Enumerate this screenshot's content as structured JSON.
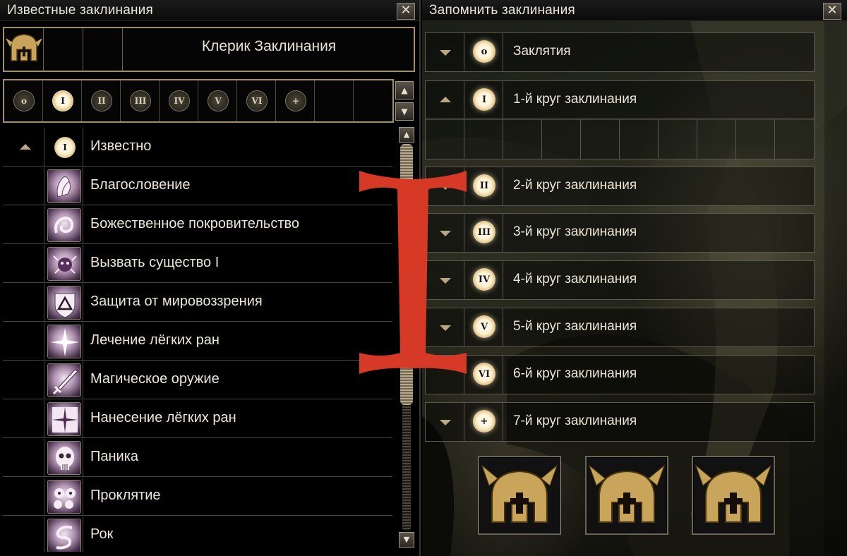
{
  "known_window": {
    "title": "Известные заклинания",
    "close_label": "✕",
    "class_name": "Клерик Заклинания",
    "level_tabs": [
      {
        "label": "o",
        "active": false
      },
      {
        "label": "I",
        "active": true
      },
      {
        "label": "II",
        "active": false
      },
      {
        "label": "III",
        "active": false
      },
      {
        "label": "IV",
        "active": false
      },
      {
        "label": "V",
        "active": false
      },
      {
        "label": "VI",
        "active": false
      },
      {
        "label": "+",
        "active": false
      },
      {
        "label": "",
        "active": false
      },
      {
        "label": "",
        "active": false
      }
    ],
    "spin_up": "▲",
    "spin_down": "▼",
    "list_header": {
      "rune": "I",
      "label": "Известно"
    },
    "spells": [
      {
        "label": "Благословение",
        "icon": "praying-hands-icon"
      },
      {
        "label": "Божественное покровительство",
        "icon": "ankh-swirl-icon"
      },
      {
        "label": "Вызвать существо I",
        "icon": "summon-creature-icon"
      },
      {
        "label": "Защита от мировоззрения",
        "icon": "shield-triangle-icon"
      },
      {
        "label": "Лечение лёгких ран",
        "icon": "healing-star-icon"
      },
      {
        "label": "Магическое оружие",
        "icon": "sword-icon"
      },
      {
        "label": "Нанесение лёгких ран",
        "icon": "wound-star-icon"
      },
      {
        "label": "Паника",
        "icon": "skull-icon"
      },
      {
        "label": "Проклятие",
        "icon": "curse-faces-icon"
      },
      {
        "label": "Рок",
        "icon": "doom-snake-icon"
      }
    ],
    "scroll_up": "▲",
    "scroll_down": "▼"
  },
  "memorize_window": {
    "title": "Запомнить заклинания",
    "close_label": "✕",
    "rows": [
      {
        "rune": "o",
        "label": "Заклятия",
        "expanded": false
      },
      {
        "rune": "I",
        "label": "1-й круг заклинания",
        "expanded": true
      },
      {
        "rune": "II",
        "label": "2-й круг заклинания",
        "expanded": false
      },
      {
        "rune": "III",
        "label": "3-й круг заклинания",
        "expanded": false
      },
      {
        "rune": "IV",
        "label": "4-й круг заклинания",
        "expanded": false
      },
      {
        "rune": "V",
        "label": "5-й круг заклинания",
        "expanded": false
      },
      {
        "rune": "VI",
        "label": "6-й круг заклинания",
        "expanded": false
      },
      {
        "rune": "+",
        "label": "7-й круг заклинания",
        "expanded": false
      }
    ],
    "empty_slots_count": 10,
    "helmet_buttons": [
      "helmet-icon",
      "helmet-icon",
      "helmet-icon"
    ]
  },
  "colors": {
    "frame_gold": "#a08f6a",
    "rune_glow": "#fff2d2",
    "overlay_red": "#d63a26"
  }
}
